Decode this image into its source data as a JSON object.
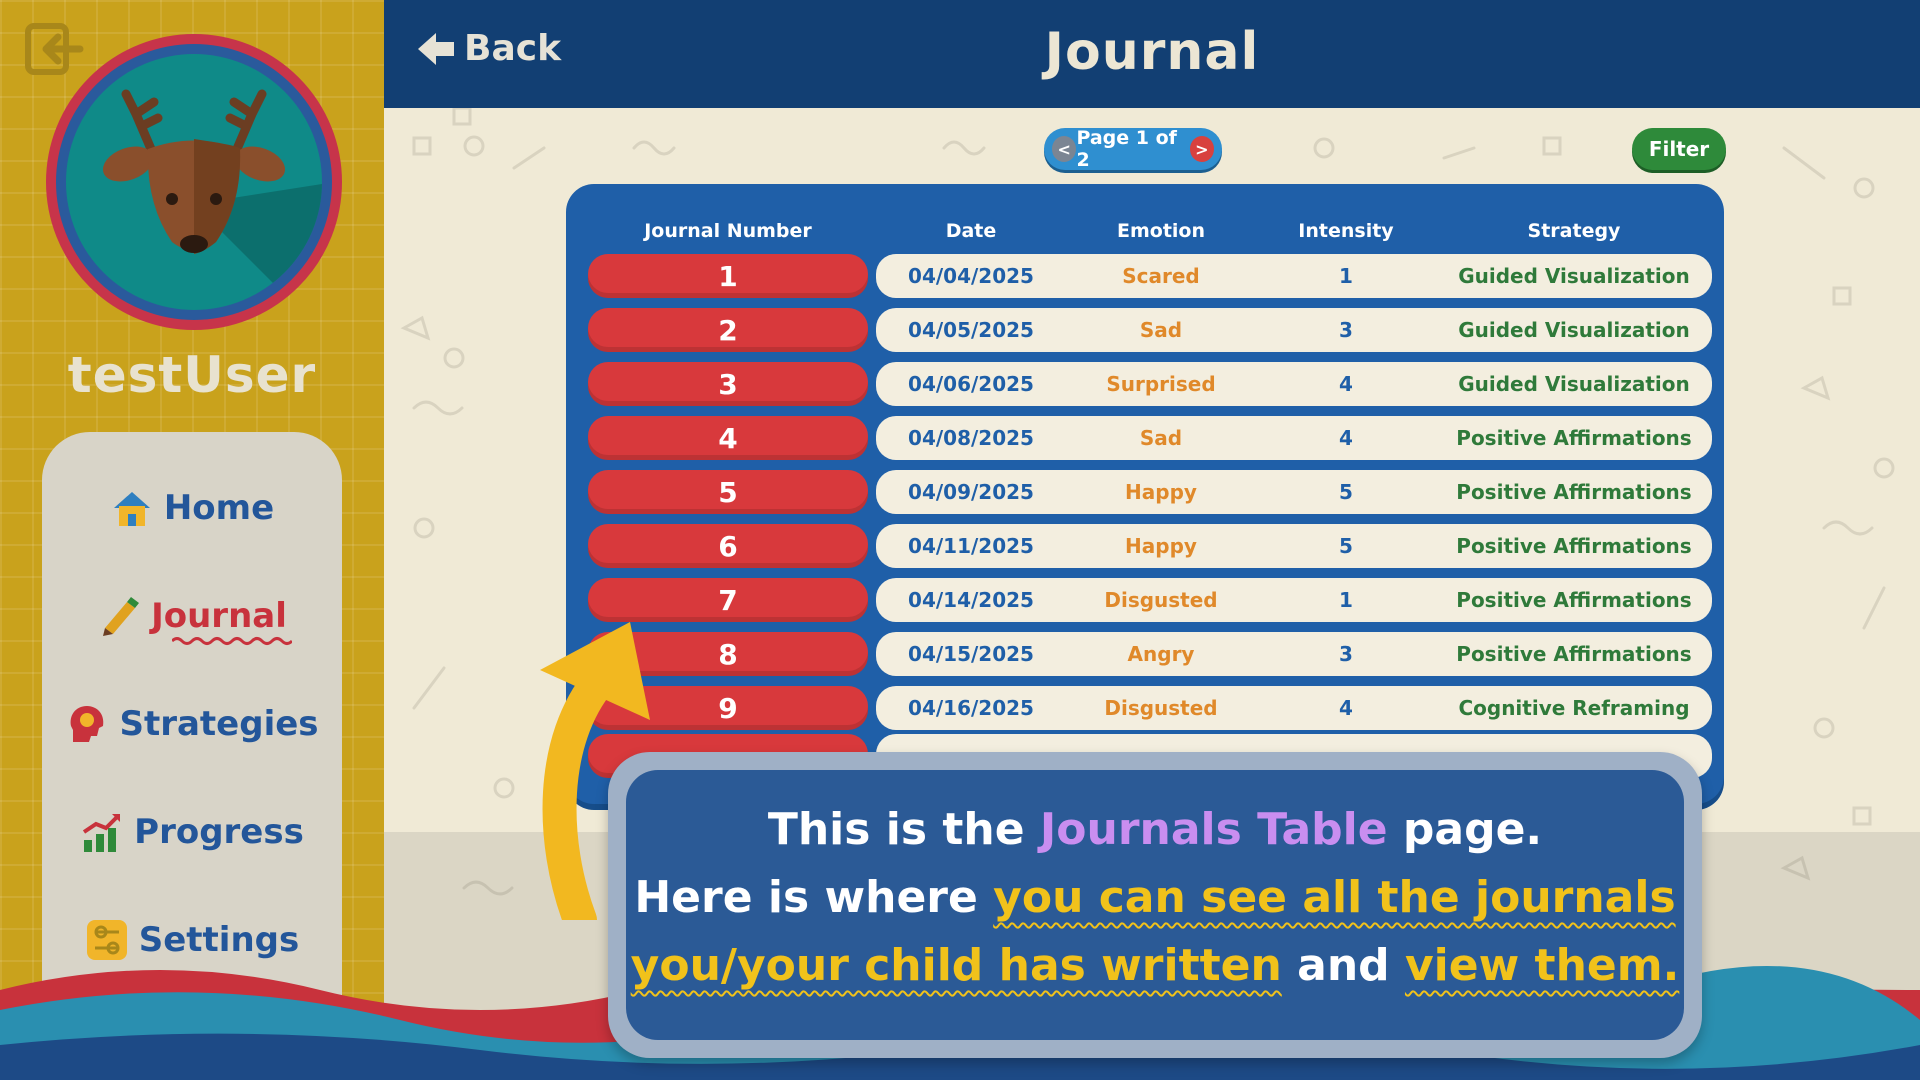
{
  "sidebar": {
    "username": "testUser",
    "nav": [
      {
        "label": "Home",
        "icon": "house-icon",
        "active": false
      },
      {
        "label": "Journal",
        "icon": "pencil-icon",
        "active": true
      },
      {
        "label": "Strategies",
        "icon": "head-icon",
        "active": false
      },
      {
        "label": "Progress",
        "icon": "chart-up-icon",
        "active": false
      },
      {
        "label": "Settings",
        "icon": "sliders-icon",
        "active": false
      }
    ]
  },
  "header": {
    "back_label": "Back",
    "title": "Journal"
  },
  "pager": {
    "prev": "<",
    "label": "Page 1 of 2",
    "next": ">"
  },
  "filter_label": "Filter",
  "table": {
    "headers": [
      "Journal Number",
      "Date",
      "Emotion",
      "Intensity",
      "Strategy"
    ],
    "rows": [
      {
        "num": "1",
        "date": "04/04/2025",
        "emotion": "Scared",
        "intensity": "1",
        "strategy": "Guided Visualization"
      },
      {
        "num": "2",
        "date": "04/05/2025",
        "emotion": "Sad",
        "intensity": "3",
        "strategy": "Guided Visualization"
      },
      {
        "num": "3",
        "date": "04/06/2025",
        "emotion": "Surprised",
        "intensity": "4",
        "strategy": "Guided Visualization"
      },
      {
        "num": "4",
        "date": "04/08/2025",
        "emotion": "Sad",
        "intensity": "4",
        "strategy": "Positive Affirmations"
      },
      {
        "num": "5",
        "date": "04/09/2025",
        "emotion": "Happy",
        "intensity": "5",
        "strategy": "Positive Affirmations"
      },
      {
        "num": "6",
        "date": "04/11/2025",
        "emotion": "Happy",
        "intensity": "5",
        "strategy": "Positive Affirmations"
      },
      {
        "num": "7",
        "date": "04/14/2025",
        "emotion": "Disgusted",
        "intensity": "1",
        "strategy": "Positive Affirmations"
      },
      {
        "num": "8",
        "date": "04/15/2025",
        "emotion": "Angry",
        "intensity": "3",
        "strategy": "Positive Affirmations"
      },
      {
        "num": "9",
        "date": "04/16/2025",
        "emotion": "Disgusted",
        "intensity": "4",
        "strategy": "Cognitive Reframing"
      }
    ]
  },
  "tutorial": {
    "line1_a": "This is the ",
    "line1_b": "Journals Table",
    "line1_c": " page.",
    "line2_a": "Here is where ",
    "line2_b": "you can see all the journals",
    "line3_a": "you/your child has written",
    "line3_b": " and ",
    "line3_c": "view them."
  },
  "colors": {
    "sidebar": "#c9a21c",
    "header": "#123f73",
    "table": "#1f5fa8",
    "number_pill": "#d8393c",
    "emotion_text": "#e0892a",
    "strategy_text": "#2f7a3a",
    "highlight_purple": "#c98ef0",
    "highlight_yellow": "#f1c21b"
  }
}
